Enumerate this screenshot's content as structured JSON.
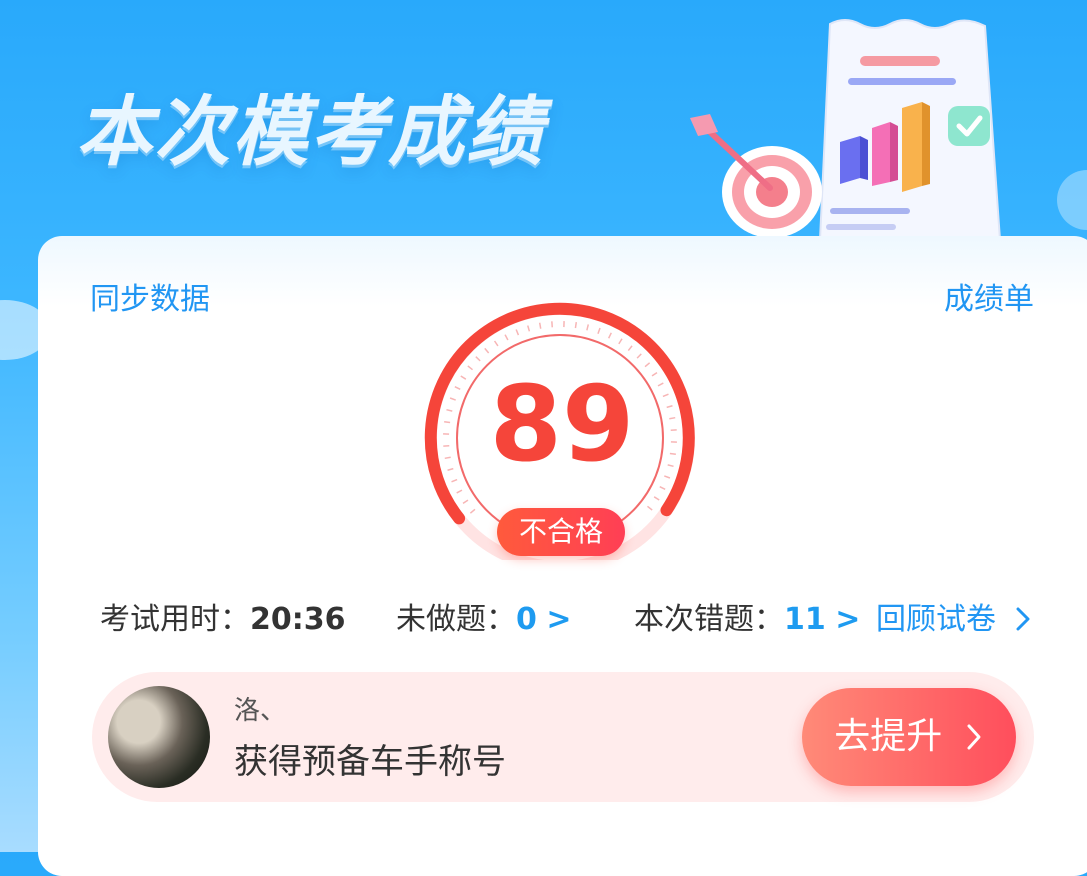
{
  "header": {
    "title": "本次模考成绩"
  },
  "card": {
    "sync_label": "同步数据",
    "report_label": "成绩单",
    "score": "89",
    "result": "不合格",
    "stats": {
      "time_label": "考试用时：",
      "time_value": "20:36",
      "undone_label": "未做题：",
      "undone_value": "0",
      "undone_arrow": ">",
      "wrong_label": "本次错题：",
      "wrong_value": "11",
      "wrong_arrow": ">",
      "review_label": "回顾试卷"
    }
  },
  "banner": {
    "user_name": "洛、",
    "title_text": "获得预备车手称号",
    "button_label": "去提升"
  },
  "colors": {
    "score_red": "#f5453a",
    "link_blue": "#2196f3",
    "hero_blue": "#29a9fb"
  }
}
